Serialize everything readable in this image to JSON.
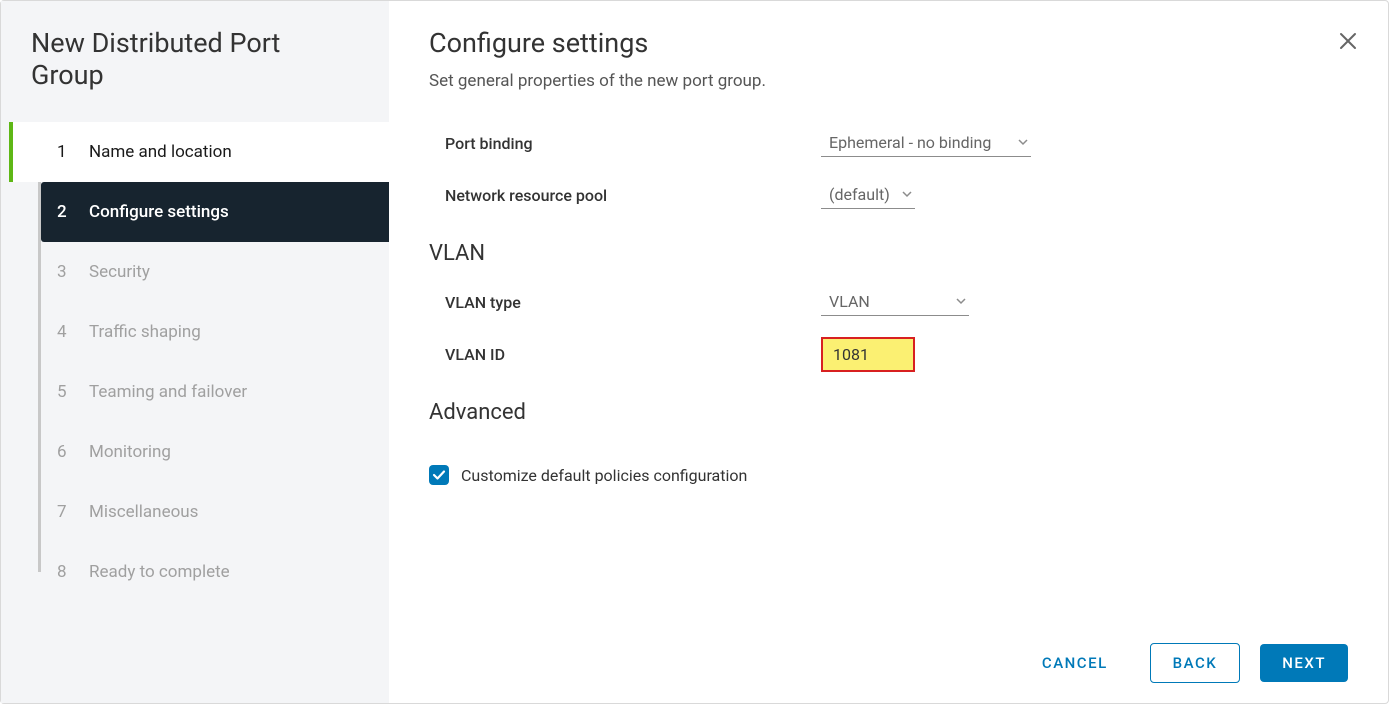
{
  "wizard": {
    "title": "New Distributed Port Group",
    "steps": [
      {
        "num": "1",
        "label": "Name and location",
        "state": "completed"
      },
      {
        "num": "2",
        "label": "Configure settings",
        "state": "active"
      },
      {
        "num": "3",
        "label": "Security",
        "state": "disabled"
      },
      {
        "num": "4",
        "label": "Traffic shaping",
        "state": "disabled"
      },
      {
        "num": "5",
        "label": "Teaming and failover",
        "state": "disabled"
      },
      {
        "num": "6",
        "label": "Monitoring",
        "state": "disabled"
      },
      {
        "num": "7",
        "label": "Miscellaneous",
        "state": "disabled"
      },
      {
        "num": "8",
        "label": "Ready to complete",
        "state": "disabled"
      }
    ]
  },
  "page": {
    "title": "Configure settings",
    "subtitle": "Set general properties of the new port group."
  },
  "form": {
    "port_binding_label": "Port binding",
    "port_binding_value": "Ephemeral - no binding",
    "nrp_label": "Network resource pool",
    "nrp_value": "(default)",
    "vlan_section": "VLAN",
    "vlan_type_label": "VLAN type",
    "vlan_type_value": "VLAN",
    "vlan_id_label": "VLAN ID",
    "vlan_id_value": "1081",
    "advanced_section": "Advanced",
    "customize_label": "Customize default policies configuration",
    "customize_checked": true
  },
  "footer": {
    "cancel": "CANCEL",
    "back": "BACK",
    "next": "NEXT"
  },
  "icons": {
    "close": "close-icon",
    "chevron_down": "chevron-down-icon",
    "check": "check-icon"
  },
  "colors": {
    "accent": "#0079b8",
    "step_active_bg": "#17242f",
    "step_completed_accent": "#5eb715",
    "highlight_bg": "#fbf072",
    "highlight_border": "#d82020"
  }
}
